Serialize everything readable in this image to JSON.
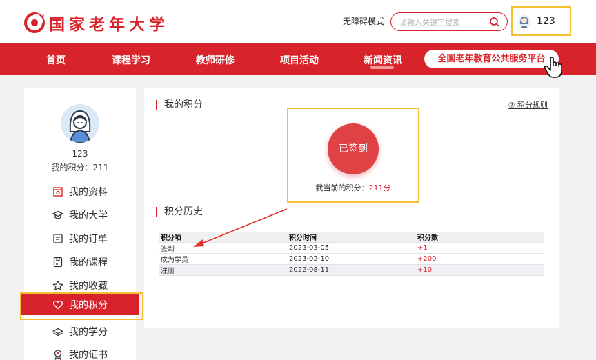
{
  "header": {
    "logo_text": "国家老年大学",
    "accessibility_label": "无障碍模式",
    "search_placeholder": "请输入关键字搜索",
    "username": "123",
    "brand_color": "#d8232a"
  },
  "nav": {
    "items": [
      "首页",
      "课程学习",
      "教师研修",
      "项目活动",
      "新闻资讯"
    ],
    "platform_label": "全国老年教育公共服务平台"
  },
  "sidebar": {
    "username": "123",
    "points_text": "我的积分：211",
    "items": [
      {
        "label": "我的资料",
        "icon": "profile-icon"
      },
      {
        "label": "我的大学",
        "icon": "graduation-cap-icon"
      },
      {
        "label": "我的订单",
        "icon": "order-icon"
      },
      {
        "label": "我的课程",
        "icon": "course-icon"
      },
      {
        "label": "我的收藏",
        "icon": "star-icon"
      },
      {
        "label": "我的积分",
        "icon": "heart-icon"
      },
      {
        "label": "我的学分",
        "icon": "credit-icon"
      },
      {
        "label": "我的证书",
        "icon": "certificate-icon"
      }
    ],
    "active_index": 5
  },
  "main": {
    "title": "我的积分",
    "rules_link": "积分规则",
    "signin_button": "已签到",
    "current_points_label": "我当前的积分：",
    "current_points_value": "211分",
    "history_title": "积分历史",
    "table": {
      "headers": [
        "积分项",
        "积分时间",
        "积分数"
      ],
      "rows": [
        [
          "签到",
          "2023-03-05",
          "+1"
        ],
        [
          "成为学员",
          "2023-02-10",
          "+200"
        ],
        [
          "注册",
          "2022-08-11",
          "+10"
        ]
      ]
    }
  }
}
